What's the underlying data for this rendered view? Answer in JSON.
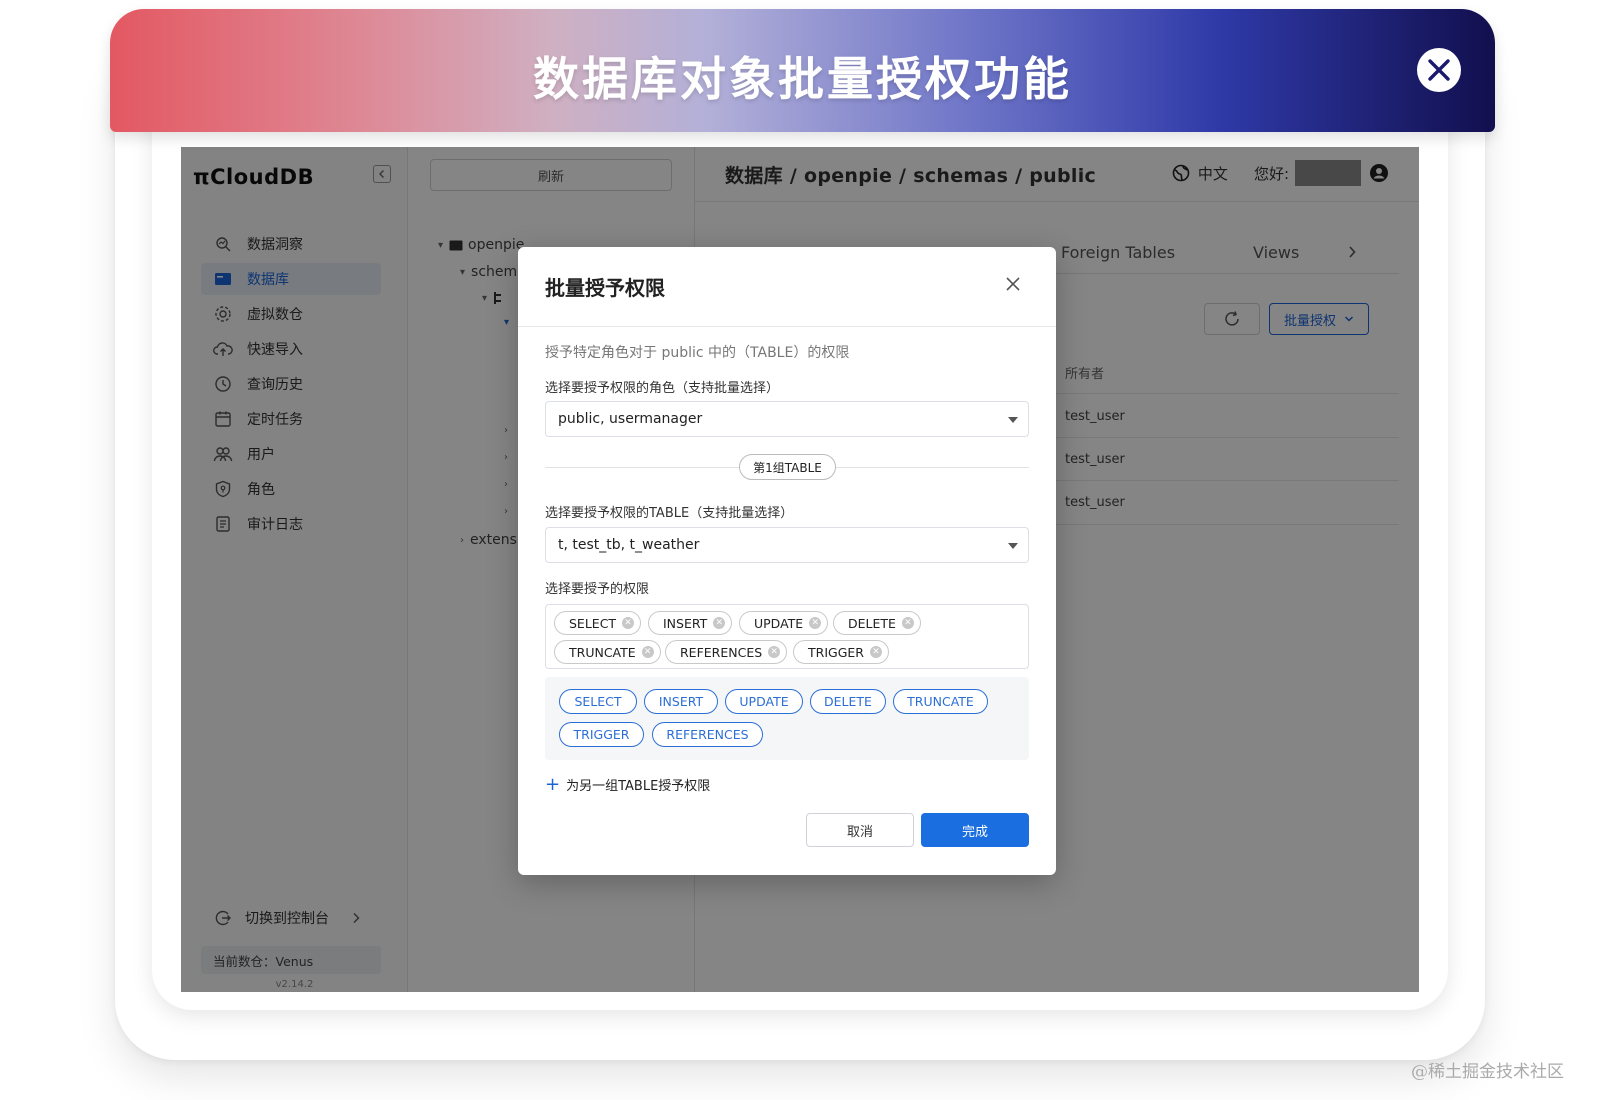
{
  "banner": {
    "title": "数据库对象批量授权功能"
  },
  "app": {
    "logo": "πCloudDB",
    "sidebar": {
      "items": [
        {
          "label": "数据洞察",
          "icon": "insight-icon"
        },
        {
          "label": "数据库",
          "icon": "database-icon",
          "active": true
        },
        {
          "label": "虚拟数仓",
          "icon": "warehouse-icon"
        },
        {
          "label": "快速导入",
          "icon": "cloud-upload-icon"
        },
        {
          "label": "查询历史",
          "icon": "history-icon"
        },
        {
          "label": "定时任务",
          "icon": "calendar-icon"
        },
        {
          "label": "用户",
          "icon": "users-icon"
        },
        {
          "label": "角色",
          "icon": "shield-icon"
        },
        {
          "label": "审计日志",
          "icon": "audit-log-icon"
        }
      ],
      "switch_console": "切换到控制台",
      "current_warehouse": "当前数仓：Venus",
      "version": "v2.14.2"
    },
    "tree": {
      "refresh_label": "刷新",
      "nodes": {
        "openpie": "openpie",
        "schemas": "schema",
        "extensions": "extensic"
      }
    },
    "main": {
      "breadcrumb": "数据库 / openpie / schemas / public",
      "language": "中文",
      "greeting": "您好:",
      "tabs": [
        "Foreign Tables",
        "Views"
      ],
      "batch_grant_label": "批量授权",
      "owner_header": "所有者",
      "owners": [
        "test_user",
        "test_user",
        "test_user"
      ]
    }
  },
  "dialog": {
    "title": "批量授予权限",
    "description": "授予特定角色对于 public 中的（TABLE）的权限",
    "role_label": "选择要授予权限的角色（支持批量选择）",
    "role_value": "public, usermanager",
    "group_label": "第1组TABLE",
    "table_label": "选择要授予权限的TABLE（支持批量选择）",
    "table_value": "t, test_tb, t_weather",
    "priv_label": "选择要授予的权限",
    "selected_privileges": [
      "SELECT",
      "INSERT",
      "UPDATE",
      "DELETE",
      "TRUNCATE",
      "REFERENCES",
      "TRIGGER"
    ],
    "privilege_options": [
      "SELECT",
      "INSERT",
      "UPDATE",
      "DELETE",
      "TRUNCATE",
      "TRIGGER",
      "REFERENCES"
    ],
    "add_group_label": "为另一组TABLE授予权限",
    "cancel_label": "取消",
    "done_label": "完成"
  },
  "watermark": "@稀土掘金技术社区",
  "colors": {
    "primary": "#1b6ee0",
    "overlay": "rgba(0,0,0,0.48)"
  }
}
